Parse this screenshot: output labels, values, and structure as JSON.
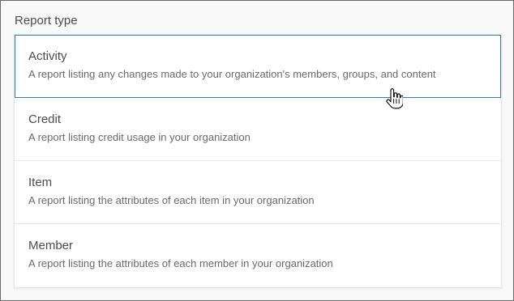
{
  "report_type": {
    "label": "Report type",
    "options": [
      {
        "title": "Activity",
        "description": "A report listing any changes made to your organization's members, groups, and content",
        "selected": true
      },
      {
        "title": "Credit",
        "description": "A report listing credit usage in your organization",
        "selected": false
      },
      {
        "title": "Item",
        "description": "A report listing the attributes of each item in your organization",
        "selected": false
      },
      {
        "title": "Member",
        "description": "A report listing the attributes of each member in your organization",
        "selected": false
      }
    ]
  },
  "colors": {
    "selected_border": "#2b7fbd",
    "text": "#4c4c4c",
    "muted_text": "#6a6a6a",
    "card_background": "#ffffff",
    "page_background": "#f8f8f8"
  },
  "icons": {
    "cursor": "hand-pointer-icon"
  }
}
